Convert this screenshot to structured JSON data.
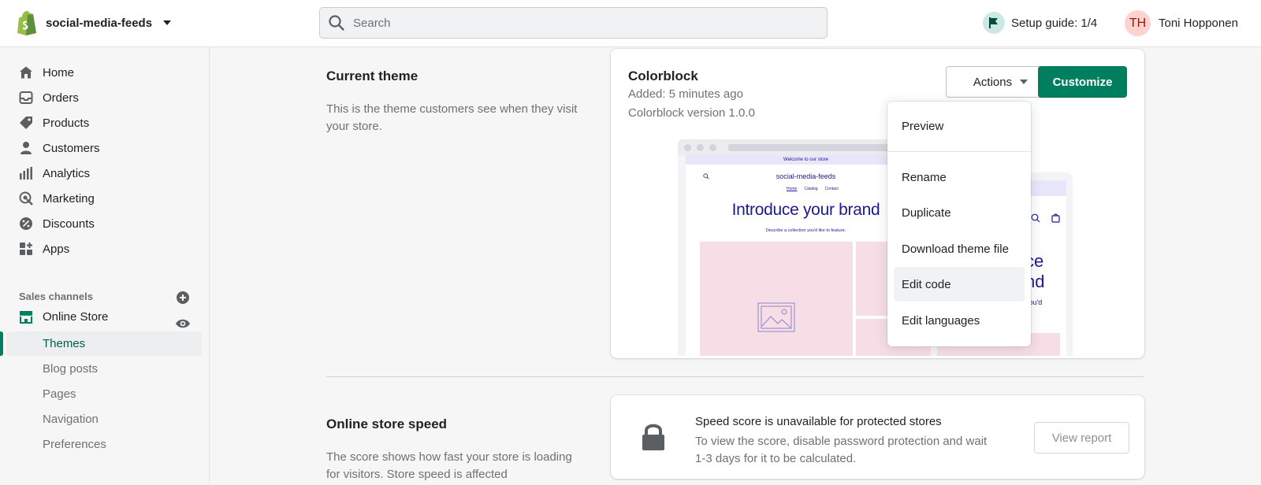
{
  "topbar": {
    "store_name": "social-media-feeds",
    "search_placeholder": "Search",
    "setup_guide": "Setup guide: 1/4",
    "user_initials": "TH",
    "user_name": "Toni Hopponen"
  },
  "sidebar": {
    "items": [
      {
        "label": "Home",
        "icon": "home-icon"
      },
      {
        "label": "Orders",
        "icon": "orders-icon"
      },
      {
        "label": "Products",
        "icon": "products-icon"
      },
      {
        "label": "Customers",
        "icon": "customers-icon"
      },
      {
        "label": "Analytics",
        "icon": "analytics-icon"
      },
      {
        "label": "Marketing",
        "icon": "marketing-icon"
      },
      {
        "label": "Discounts",
        "icon": "discounts-icon"
      },
      {
        "label": "Apps",
        "icon": "apps-icon"
      }
    ],
    "sales_channels_label": "Sales channels",
    "online_store": "Online Store",
    "sub_items": [
      "Themes",
      "Blog posts",
      "Pages",
      "Navigation",
      "Preferences"
    ],
    "active_sub": "Themes"
  },
  "current_theme": {
    "title": "Current theme",
    "description": "This is the theme customers see when they visit your store.",
    "theme_name": "Colorblock",
    "added": "Added: 5 minutes ago",
    "version": "Colorblock version 1.0.0",
    "actions_label": "Actions",
    "customize_label": "Customize"
  },
  "preview": {
    "announcement": "Welcome to our store",
    "store_title": "social-media-feeds",
    "nav": [
      "Home",
      "Catalog",
      "Contact"
    ],
    "heading": "Introduce your brand",
    "subtext": "Describe a collection you'd like to feature.",
    "mobile_announcement": "ore",
    "mobile_heading_1": "ce",
    "mobile_heading_2": "nd",
    "mobile_subtext": "you'd"
  },
  "actions_menu": {
    "items": [
      "Preview",
      "Rename",
      "Duplicate",
      "Download theme file",
      "Edit code",
      "Edit languages"
    ],
    "hovered": "Edit code"
  },
  "speed": {
    "title": "Online store speed",
    "description": "The score shows how fast your store is loading for visitors. Store speed is affected",
    "card_title": "Speed score is unavailable for protected stores",
    "card_desc": "To view the score, disable password protection and wait 1-3 days for it to be calculated.",
    "view_report": "View report"
  },
  "colors": {
    "primary": "#007f5f",
    "accent_navy": "#1c1a8c",
    "preview_pink": "#f7dde6"
  }
}
